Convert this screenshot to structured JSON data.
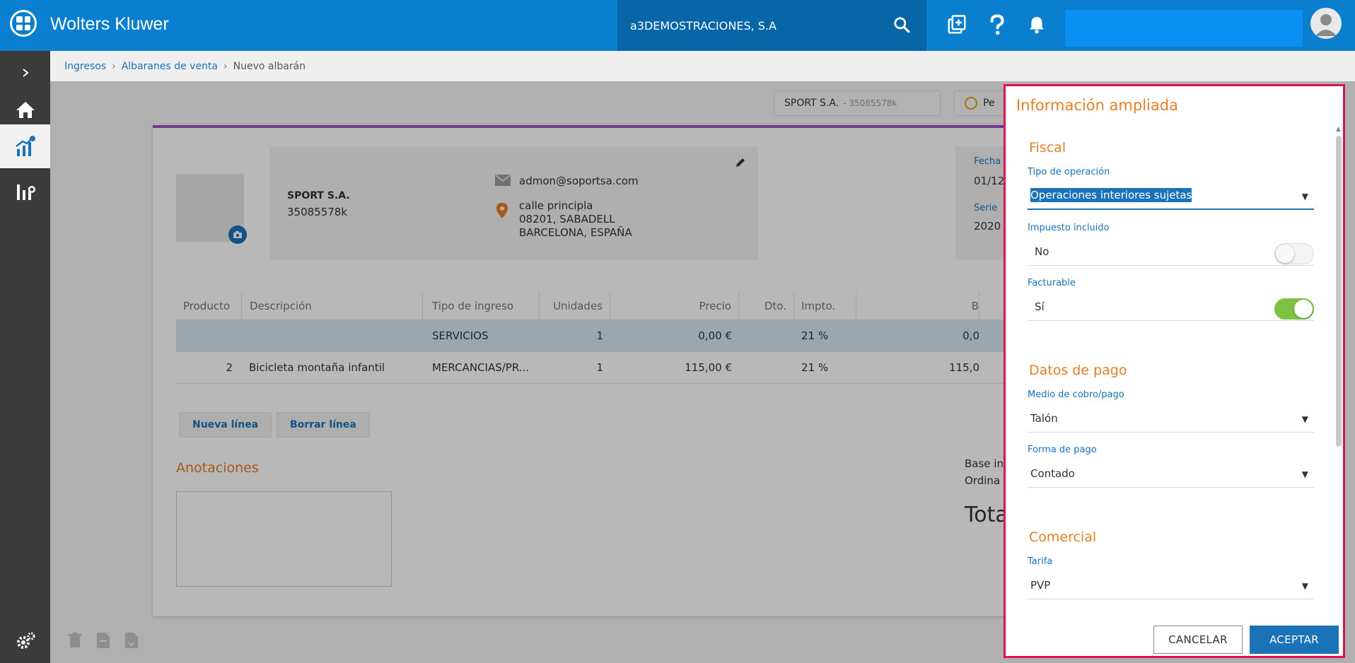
{
  "topbar": {
    "brand": "Wolters Kluwer",
    "company": "a3DEMOSTRACIONES, S.A"
  },
  "breadcrumb": {
    "items": [
      "Ingresos",
      "Albaranes de venta",
      "Nuevo albarán"
    ]
  },
  "page": {
    "chip_client_name": "SPORT S.A.",
    "chip_client_sub": "- 35085578k",
    "chip_status": "Pe",
    "client": {
      "name": "SPORT S.A.",
      "nif": "35085578k",
      "email": "admon@soportsa.com",
      "address_line1": "calle principla",
      "address_line2": "08201, SABADELL",
      "address_line3": "BARCELONA, ESPAÑA"
    },
    "date_label": "Fecha",
    "date_value": "01/12",
    "series_label": "Serie",
    "series_value": "2020",
    "grid": {
      "headers": [
        "Producto",
        "Descripción",
        "Tipo de ingreso",
        "Unidades",
        "Precio",
        "Dto.",
        "Impto.",
        "B"
      ],
      "rows": [
        {
          "producto": "",
          "descripcion": "",
          "tipo": "SERVICIOS",
          "unidades": "1",
          "precio": "0,00 €",
          "dto": "",
          "impto": "21 %",
          "base": "0,0"
        },
        {
          "producto": "2",
          "descripcion": "Bicicleta montaña infantil",
          "tipo": "MERCANCIAS/PR...",
          "unidades": "1",
          "precio": "115,00 €",
          "dto": "",
          "impto": "21 %",
          "base": "115,0"
        }
      ],
      "new_line": "Nueva línea",
      "delete_line": "Borrar línea"
    },
    "notes_title": "Anotaciones",
    "totals_base": "Base in",
    "totals_ordinary": "Ordina",
    "totals_total": "Tota"
  },
  "panel": {
    "title": "Información ampliada",
    "fiscal": {
      "section": "Fiscal",
      "operation_label": "Tipo de operación",
      "operation_value": "Operaciones interiores sujetas",
      "tax_included_label": "Impuesto incluido",
      "tax_included_value": "No",
      "tax_included_on": false,
      "billable_label": "Facturable",
      "billable_value": "Sí",
      "billable_on": true
    },
    "payment": {
      "section": "Datos de pago",
      "method_label": "Medio de cobro/pago",
      "method_value": "Talón",
      "form_label": "Forma de pago",
      "form_value": "Contado"
    },
    "commercial": {
      "section": "Comercial",
      "rate_label": "Tarifa",
      "rate_value": "PVP"
    },
    "cancel": "CANCELAR",
    "accept": "ACEPTAR"
  },
  "colors": {
    "primary": "#0a7fd0",
    "accent_orange": "#e67e22",
    "modal_border": "#e0114f",
    "toggle_on": "#7dc242",
    "card_top_border": "#9a4fc3"
  },
  "icons": {
    "search": "search-icon",
    "add_document": "add-document-icon",
    "help": "help-icon",
    "notifications": "bell-icon",
    "home": "home-icon",
    "stats": "chart-icon",
    "analytics": "analytics-icon",
    "settings": "gear-icon"
  }
}
